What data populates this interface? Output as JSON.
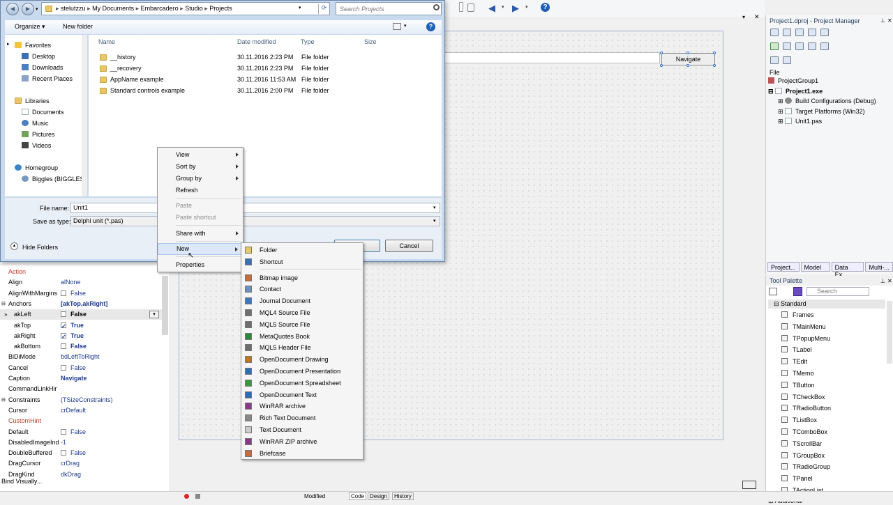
{
  "dialog": {
    "breadcrumb": [
      "stelutzzu",
      "My Documents",
      "Embarcadero",
      "Studio",
      "Projects"
    ],
    "search_placeholder": "Search Projects",
    "organize_label": "Organize ▾",
    "new_folder_label": "New folder",
    "nav": {
      "favorites": "Favorites",
      "desktop": "Desktop",
      "downloads": "Downloads",
      "recent": "Recent Places",
      "libraries": "Libraries",
      "documents": "Documents",
      "music": "Music",
      "pictures": "Pictures",
      "videos": "Videos",
      "homegroup": "Homegroup",
      "computer": "Biggles (BIGGLES"
    },
    "columns": {
      "name": "Name",
      "date": "Date modified",
      "type": "Type",
      "size": "Size"
    },
    "files": [
      {
        "name": "__history",
        "date": "30.11.2016 2:23 PM",
        "type": "File folder"
      },
      {
        "name": "__recovery",
        "date": "30.11.2016 2:23 PM",
        "type": "File folder"
      },
      {
        "name": "AppName example",
        "date": "30.11.2016 11:53 AM",
        "type": "File folder"
      },
      {
        "name": "Standard controls example",
        "date": "30.11.2016 2:00 PM",
        "type": "File folder"
      }
    ],
    "file_name_label": "File name:",
    "file_name_value": "Unit1",
    "save_type_label": "Save as type:",
    "save_type_value": "Delphi unit (*.pas)",
    "hide_folders": "Hide Folders",
    "cancel": "Cancel"
  },
  "context_menu": {
    "view": "View",
    "sort_by": "Sort by",
    "group_by": "Group by",
    "refresh": "Refresh",
    "paste": "Paste",
    "paste_shortcut": "Paste shortcut",
    "share_with": "Share with",
    "new": "New",
    "properties": "Properties"
  },
  "new_submenu": [
    "Folder",
    "Shortcut",
    "Bitmap image",
    "Contact",
    "Journal Document",
    "MQL4 Source File",
    "MQL5 Source File",
    "MetaQuotes Book",
    "MQL5 Header File",
    "OpenDocument Drawing",
    "OpenDocument Presentation",
    "OpenDocument Spreadsheet",
    "OpenDocument Text",
    "WinRAR archive",
    "Rich Text Document",
    "Text Document",
    "WinRAR ZIP archive",
    "Briefcase"
  ],
  "designer": {
    "navigate_button": "Navigate"
  },
  "inspector": {
    "rows": [
      {
        "k": "Action",
        "v": "",
        "kc": "#c0392b"
      },
      {
        "k": "Align",
        "v": "alNone",
        "vc": "#1c3a8c"
      },
      {
        "k": "AlignWithMargins",
        "v": "False",
        "cb": true,
        "vc": "#1c3a8c"
      },
      {
        "k": "Anchors",
        "v": "[akTop,akRight]",
        "vc": "#1c3a8c",
        "b": true
      },
      {
        "k": "akLeft",
        "v": "False",
        "cb": true,
        "b": true
      },
      {
        "k": "akTop",
        "v": "True",
        "cb": true,
        "on": true,
        "b": true,
        "vc": "#1c3a8c"
      },
      {
        "k": "akRight",
        "v": "True",
        "cb": true,
        "on": true,
        "b": true,
        "vc": "#1c3a8c"
      },
      {
        "k": "akBottom",
        "v": "False",
        "cb": true,
        "b": true,
        "vc": "#1c3a8c"
      },
      {
        "k": "BiDiMode",
        "v": "bdLeftToRight",
        "vc": "#1c3a8c"
      },
      {
        "k": "Cancel",
        "v": "False",
        "cb": true,
        "vc": "#1c3a8c"
      },
      {
        "k": "Caption",
        "v": "Navigate",
        "b": true,
        "vc": "#1c3a8c"
      },
      {
        "k": "CommandLinkHir",
        "v": ""
      },
      {
        "k": "Constraints",
        "v": "(TSizeConstraints)",
        "vc": "#1c3a8c"
      },
      {
        "k": "Cursor",
        "v": "crDefault",
        "vc": "#1c3a8c"
      },
      {
        "k": "CustomHint",
        "v": "",
        "kc": "#c0392b"
      },
      {
        "k": "Default",
        "v": "False",
        "cb": true,
        "vc": "#1c3a8c"
      },
      {
        "k": "DisabledImageInd",
        "v": "-1",
        "vc": "#1c3a8c"
      },
      {
        "k": "DoubleBuffered",
        "v": "False",
        "cb": true,
        "vc": "#1c3a8c"
      },
      {
        "k": "DragCursor",
        "v": "crDrag",
        "vc": "#1c3a8c"
      },
      {
        "k": "DragKind",
        "v": "dkDrag",
        "vc": "#1c3a8c"
      }
    ],
    "bind_visually": "Bind Visually..."
  },
  "project_manager": {
    "title": "Project1.dproj - Project Manager",
    "file_label": "File",
    "group": "ProjectGroup1",
    "exe": "Project1.exe",
    "build": "Build Configurations (Debug)",
    "target": "Target Platforms (Win32)",
    "unit": "Unit1.pas",
    "tabs": [
      "Project...",
      "Model ...",
      "Data Ex...",
      "Multi-..."
    ]
  },
  "tool_palette": {
    "title": "Tool Palette",
    "search_placeholder": "Search",
    "category": "Standard",
    "items": [
      "Frames",
      "TMainMenu",
      "TPopupMenu",
      "TLabel",
      "TEdit",
      "TMemo",
      "TButton",
      "TCheckBox",
      "TRadioButton",
      "TListBox",
      "TComboBox",
      "TScrollBar",
      "TGroupBox",
      "TRadioGroup",
      "TPanel",
      "TActionList"
    ],
    "next_category": "Additional"
  },
  "bottom_tabs": {
    "code": "Code",
    "design": "Design",
    "history": "History",
    "modified": "Modified"
  }
}
